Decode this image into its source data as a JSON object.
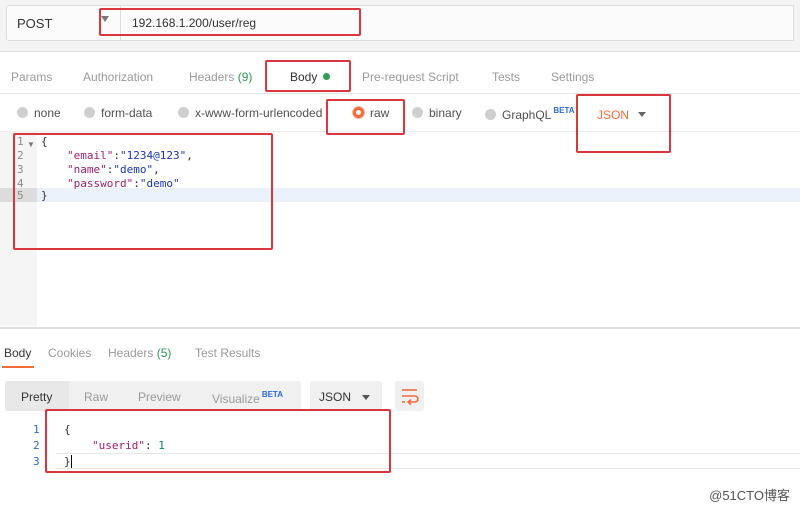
{
  "request": {
    "method": "POST",
    "url": "192.168.1.200/user/reg"
  },
  "request_tabs": [
    {
      "label": "Params"
    },
    {
      "label": "Authorization"
    },
    {
      "label": "Headers",
      "count": "(9)"
    },
    {
      "label": "Body"
    },
    {
      "label": "Pre-request Script"
    },
    {
      "label": "Tests"
    },
    {
      "label": "Settings"
    }
  ],
  "body_modes": [
    {
      "label": "none",
      "selected": false
    },
    {
      "label": "form-data",
      "selected": false
    },
    {
      "label": "x-www-form-urlencoded",
      "selected": false
    },
    {
      "label": "raw",
      "selected": true
    },
    {
      "label": "binary",
      "selected": false
    },
    {
      "label": "GraphQL",
      "selected": false,
      "badge": "BETA"
    }
  ],
  "body_format": "JSON",
  "request_body": {
    "line_numbers": [
      "1",
      "2",
      "3",
      "4",
      "5"
    ],
    "lines": [
      {
        "open": "{"
      },
      {
        "key": "\"email\"",
        "sep": ":",
        "value": "\"1234@123\"",
        "end": ","
      },
      {
        "key": "\"name\"",
        "sep": ":",
        "value": "\"demo\"",
        "end": ","
      },
      {
        "key": "\"password\"",
        "sep": ":",
        "value": "\"demo\"",
        "end": ""
      },
      {
        "close": "}"
      }
    ]
  },
  "response_tabs": [
    {
      "label": "Body"
    },
    {
      "label": "Cookies"
    },
    {
      "label": "Headers",
      "count": "(5)"
    },
    {
      "label": "Test Results"
    }
  ],
  "response_views": [
    {
      "label": "Pretty"
    },
    {
      "label": "Raw"
    },
    {
      "label": "Preview"
    },
    {
      "label": "Visualize",
      "badge": "BETA"
    }
  ],
  "response_format": "JSON",
  "response_body": {
    "line_numbers": [
      "1",
      "2",
      "3"
    ],
    "open": "{",
    "key": "\"userid\"",
    "sep": ": ",
    "value": "1",
    "close": "}"
  },
  "watermark": "@51CTO博客",
  "colors": {
    "accent": "#f26b3a",
    "highlight_box": "#d9363e",
    "success": "#2a9e55"
  }
}
